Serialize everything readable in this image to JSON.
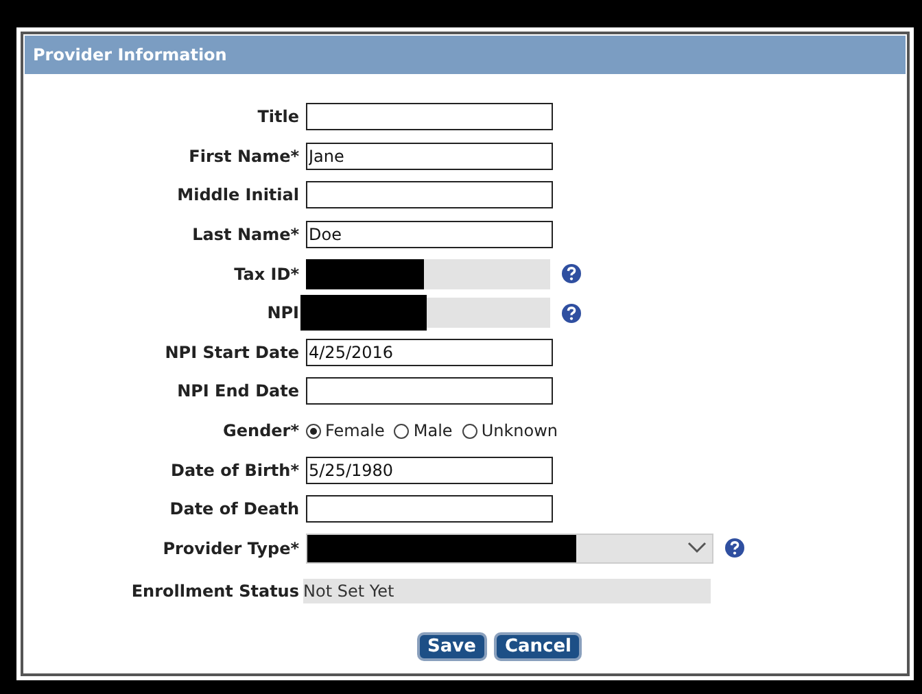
{
  "dialog": {
    "title": "Provider Information"
  },
  "fields": [
    {
      "kind": "text",
      "label": "Title"
    },
    {
      "kind": "text",
      "label": "First Name*",
      "value": "Jane"
    },
    {
      "kind": "text",
      "label": "Middle Initial"
    },
    {
      "kind": "text",
      "label": "Last Name*",
      "value": "Doe"
    },
    {
      "kind": "redacted",
      "label": "Tax ID*",
      "help": true
    },
    {
      "kind": "redacted",
      "label": "NPI",
      "help": true
    },
    {
      "kind": "text",
      "label": "NPI Start Date",
      "value": "4/25/2016"
    },
    {
      "kind": "text",
      "label": "NPI End Date"
    },
    {
      "kind": "radio",
      "label": "Gender*",
      "options": [
        {
          "label": "Female",
          "selected": true
        },
        {
          "label": "Male",
          "selected": false
        },
        {
          "label": "Unknown",
          "selected": false
        }
      ]
    },
    {
      "kind": "text",
      "label": "Date of Birth*",
      "value": "5/25/1980"
    },
    {
      "kind": "text",
      "label": "Date of Death"
    },
    {
      "kind": "select",
      "label": "Provider Type*",
      "help": true
    },
    {
      "kind": "readonly",
      "label": "Enrollment Status",
      "value": "Not Set Yet"
    }
  ],
  "buttons": [
    "Save",
    "Cancel"
  ]
}
